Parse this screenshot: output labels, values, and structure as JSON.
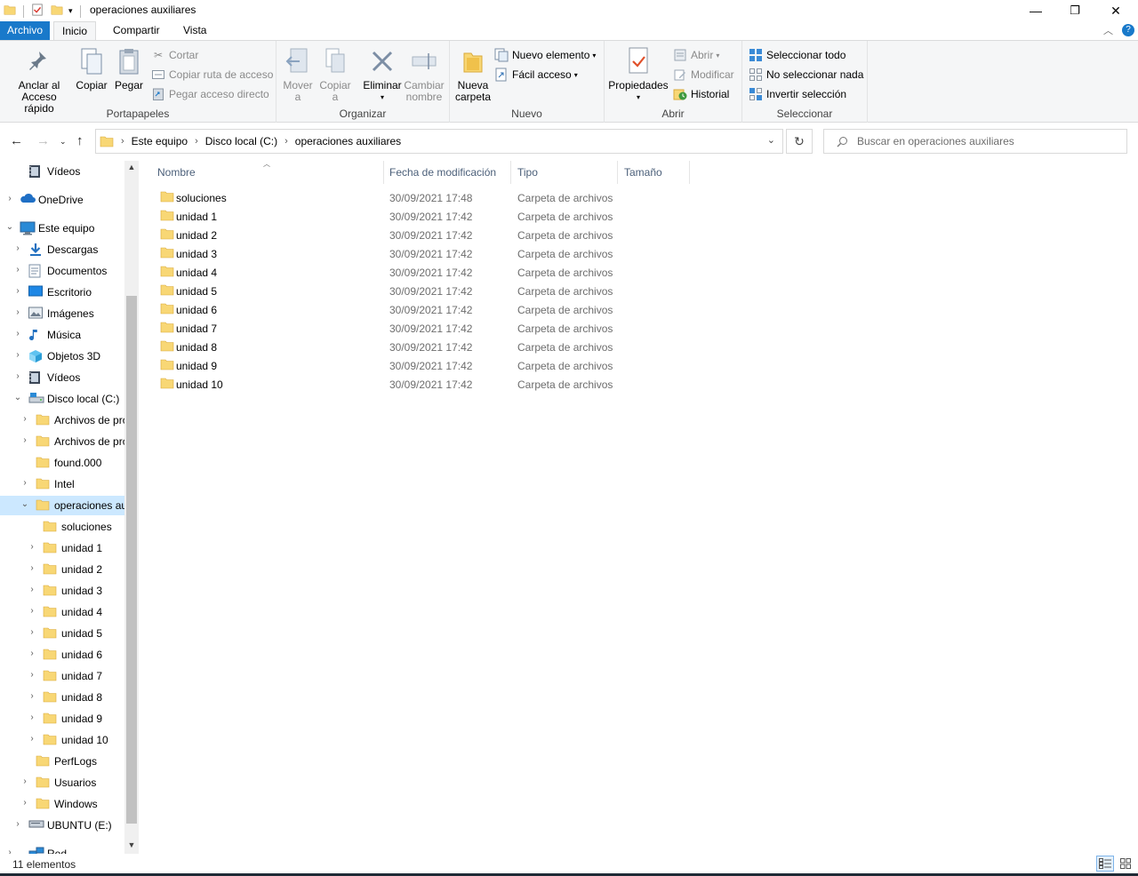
{
  "window": {
    "title": "operaciones auxiliares",
    "minimize": "—",
    "maximize": "❐",
    "close": "✕"
  },
  "tabs": {
    "file": "Archivo",
    "home": "Inicio",
    "share": "Compartir",
    "view": "Vista",
    "help_chevron": "^"
  },
  "ribbon": {
    "portapapeles": {
      "label": "Portapapeles",
      "pin_line1": "Anclar al",
      "pin_line2": "Acceso rápido",
      "copy": "Copiar",
      "paste": "Pegar",
      "cut": "Cortar",
      "copy_path": "Copiar ruta de acceso",
      "paste_shortcut": "Pegar acceso directo"
    },
    "organizar": {
      "label": "Organizar",
      "move_line1": "Mover",
      "move_line2": "a",
      "copyto_line1": "Copiar",
      "copyto_line2": "a",
      "delete": "Eliminar",
      "rename_line1": "Cambiar",
      "rename_line2": "nombre"
    },
    "nuevo": {
      "label": "Nuevo",
      "new_folder_line1": "Nueva",
      "new_folder_line2": "carpeta",
      "new_item": "Nuevo elemento",
      "easy_access": "Fácil acceso"
    },
    "abrir": {
      "label": "Abrir",
      "properties": "Propiedades",
      "open": "Abrir",
      "edit": "Modificar",
      "history": "Historial"
    },
    "seleccionar": {
      "label": "Seleccionar",
      "select_all": "Seleccionar todo",
      "select_none": "No seleccionar nada",
      "invert": "Invertir selección"
    }
  },
  "address": {
    "crumbs": [
      "Este equipo",
      "Disco local (C:)",
      "operaciones auxiliares"
    ],
    "search_placeholder": "Buscar en operaciones auxiliares"
  },
  "nav": [
    {
      "label": "Vídeos",
      "icon": "video-icon",
      "expander": ""
    },
    {
      "label": "OneDrive",
      "icon": "cloud-icon",
      "expander": "›"
    },
    {
      "label": "Este equipo",
      "icon": "computer-icon",
      "expander": "⌄"
    },
    {
      "label": "Descargas",
      "icon": "download-icon",
      "expander": "›"
    },
    {
      "label": "Documentos",
      "icon": "document-icon",
      "expander": "›"
    },
    {
      "label": "Escritorio",
      "icon": "desktop-icon",
      "expander": "›"
    },
    {
      "label": "Imágenes",
      "icon": "image-icon",
      "expander": "›"
    },
    {
      "label": "Música",
      "icon": "music-icon",
      "expander": "›"
    },
    {
      "label": "Objetos 3D",
      "icon": "cube-icon",
      "expander": "›"
    },
    {
      "label": "Vídeos",
      "icon": "video-icon",
      "expander": "›"
    },
    {
      "label": "Disco local (C:)",
      "icon": "drive-icon",
      "expander": "⌄"
    },
    {
      "label": "Archivos de pro",
      "icon": "folder-icon",
      "expander": "›"
    },
    {
      "label": "Archivos de pro",
      "icon": "folder-icon",
      "expander": "›"
    },
    {
      "label": "found.000",
      "icon": "folder-icon",
      "expander": ""
    },
    {
      "label": "Intel",
      "icon": "folder-icon",
      "expander": "›"
    },
    {
      "label": "operaciones auxiliares",
      "icon": "folder-icon",
      "expander": "⌄"
    },
    {
      "label": "soluciones",
      "icon": "folder-icon",
      "expander": ""
    },
    {
      "label": "unidad 1",
      "icon": "folder-icon",
      "expander": "›"
    },
    {
      "label": "unidad 2",
      "icon": "folder-icon",
      "expander": "›"
    },
    {
      "label": "unidad 3",
      "icon": "folder-icon",
      "expander": "›"
    },
    {
      "label": "unidad 4",
      "icon": "folder-icon",
      "expander": "›"
    },
    {
      "label": "unidad 5",
      "icon": "folder-icon",
      "expander": "›"
    },
    {
      "label": "unidad 6",
      "icon": "folder-icon",
      "expander": "›"
    },
    {
      "label": "unidad 7",
      "icon": "folder-icon",
      "expander": "›"
    },
    {
      "label": "unidad 8",
      "icon": "folder-icon",
      "expander": "›"
    },
    {
      "label": "unidad 9",
      "icon": "folder-icon",
      "expander": "›"
    },
    {
      "label": "unidad 10",
      "icon": "folder-icon",
      "expander": "›"
    },
    {
      "label": "PerfLogs",
      "icon": "folder-icon",
      "expander": ""
    },
    {
      "label": "Usuarios",
      "icon": "folder-icon",
      "expander": "›"
    },
    {
      "label": "Windows",
      "icon": "folder-icon",
      "expander": "›"
    },
    {
      "label": "UBUNTU (E:)",
      "icon": "usb-drive-icon",
      "expander": "›"
    },
    {
      "label": "Red",
      "icon": "network-icon",
      "expander": "›"
    }
  ],
  "columns": {
    "name": "Nombre",
    "date": "Fecha de modificación",
    "type": "Tipo",
    "size": "Tamaño"
  },
  "files": [
    {
      "name": "soluciones",
      "date": "30/09/2021 17:48",
      "type": "Carpeta de archivos"
    },
    {
      "name": "unidad 1",
      "date": "30/09/2021 17:42",
      "type": "Carpeta de archivos"
    },
    {
      "name": "unidad 2",
      "date": "30/09/2021 17:42",
      "type": "Carpeta de archivos"
    },
    {
      "name": "unidad 3",
      "date": "30/09/2021 17:42",
      "type": "Carpeta de archivos"
    },
    {
      "name": "unidad 4",
      "date": "30/09/2021 17:42",
      "type": "Carpeta de archivos"
    },
    {
      "name": "unidad 5",
      "date": "30/09/2021 17:42",
      "type": "Carpeta de archivos"
    },
    {
      "name": "unidad 6",
      "date": "30/09/2021 17:42",
      "type": "Carpeta de archivos"
    },
    {
      "name": "unidad 7",
      "date": "30/09/2021 17:42",
      "type": "Carpeta de archivos"
    },
    {
      "name": "unidad 8",
      "date": "30/09/2021 17:42",
      "type": "Carpeta de archivos"
    },
    {
      "name": "unidad 9",
      "date": "30/09/2021 17:42",
      "type": "Carpeta de archivos"
    },
    {
      "name": "unidad 10",
      "date": "30/09/2021 17:42",
      "type": "Carpeta de archivos"
    }
  ],
  "status": {
    "count": "11 elementos"
  },
  "colors": {
    "accent": "#1979ca",
    "selection": "#cce8ff",
    "folder": "#f8d775"
  }
}
